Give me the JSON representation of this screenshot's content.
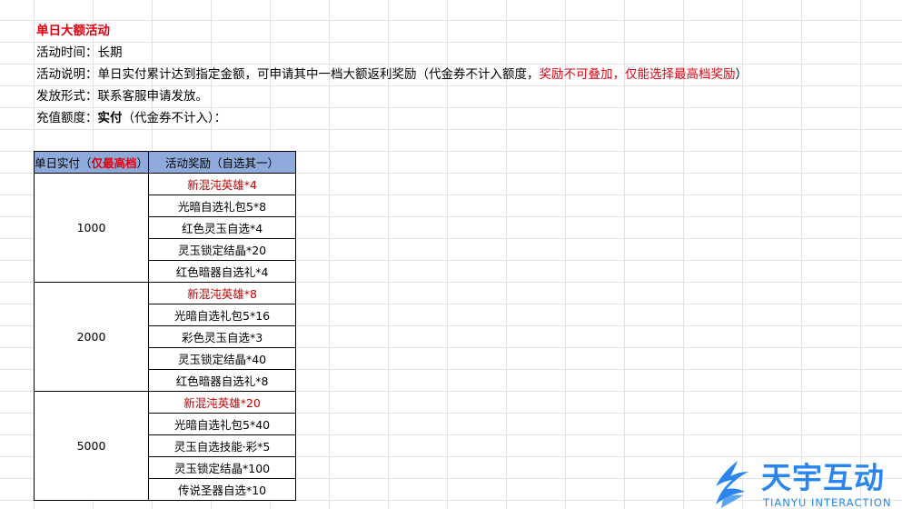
{
  "info": {
    "title": "单日大额活动",
    "time_label": "活动时间：",
    "time_value": "长期",
    "desc_label": "活动说明：",
    "desc_main": "单日实付累计达到指定金额，可申请其中一档大额返利奖励（代金券不计入额度，",
    "desc_red": "奖励不可叠加，仅能选择最高档奖励",
    "desc_end": "）",
    "issue_label": "发放形式：",
    "issue_value": "联系客服申请发放。",
    "recharge_label": "充值额度：",
    "recharge_bold": "实付",
    "recharge_rest": "（代金券不计入）："
  },
  "table": {
    "header_amount": "单日实付（",
    "header_amount_red": "仅最高档",
    "header_amount_end": "）",
    "header_reward": "活动奖励（自选其一）",
    "tiers": [
      {
        "amount": "1000",
        "rewards": [
          "新混沌英雄*4",
          "光暗自选礼包5*8",
          "红色灵玉自选*4",
          "灵玉锁定结晶*20",
          "红色暗器自选礼*4"
        ]
      },
      {
        "amount": "2000",
        "rewards": [
          "新混沌英雄*8",
          "光暗自选礼包5*16",
          "彩色灵玉自选*3",
          "灵玉锁定结晶*40",
          "红色暗器自选礼*8"
        ]
      },
      {
        "amount": "5000",
        "rewards": [
          "新混沌英雄*20",
          "光暗自选礼包5*40",
          "灵玉自选技能·彩*5",
          "灵玉锁定结晶*100",
          "传说圣器自选*10"
        ]
      }
    ]
  },
  "logo": {
    "cn": "天宇互动",
    "en": "TIANYU INTERACTION",
    "icon": "tianyu-wing-logo-icon",
    "color": "#2a86ee"
  },
  "colors": {
    "header_bg": "#8eaadb",
    "highlight_red": "#c00000",
    "title_red": "#e0000f"
  }
}
